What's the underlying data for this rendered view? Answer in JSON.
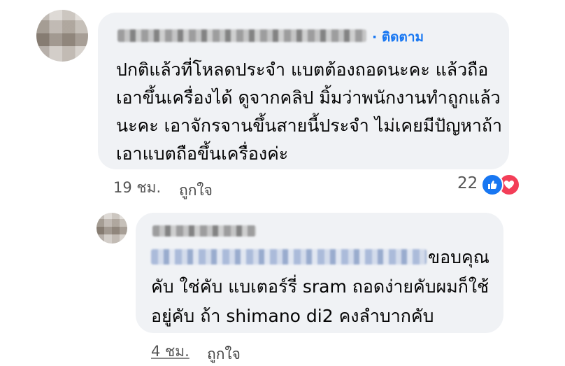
{
  "comment": {
    "follow_label": "· ติดตาม",
    "lines": [
      "ปกติแล้วที่โหลดประจำ แบตต้องถอดนะคะ แล้วถือ",
      "เอาขึ้นเครื่องได้ ดูจากคลิป มิ้มว่าพนักงานทำถูกแล้ว",
      "นะคะ  เอาจักรจานขึ้นสายนี้ประจำ ไม่เคยมีปัญหาถ้า",
      "เอาแบตถือขึ้นเครื่องค่ะ"
    ],
    "time": "19 ชม.",
    "like_label": "ถูกใจ",
    "reaction_count": "22",
    "reaction_icons": [
      "like-icon",
      "love-icon"
    ],
    "colors": {
      "accent": "#1877f2",
      "love": "#f33e58",
      "bubble": "#f0f2f5"
    }
  },
  "reply": {
    "lines": [
      "ขอบคุณ",
      "คับ ใช่คับ แบเตอร์รี่ sram ถอดง่ายคับผมก็ใช้",
      "อยู่คับ ถ้า shimano di2 คงลำบากคับ"
    ],
    "time": "4 ชม.",
    "like_label": "ถูกใจ"
  }
}
